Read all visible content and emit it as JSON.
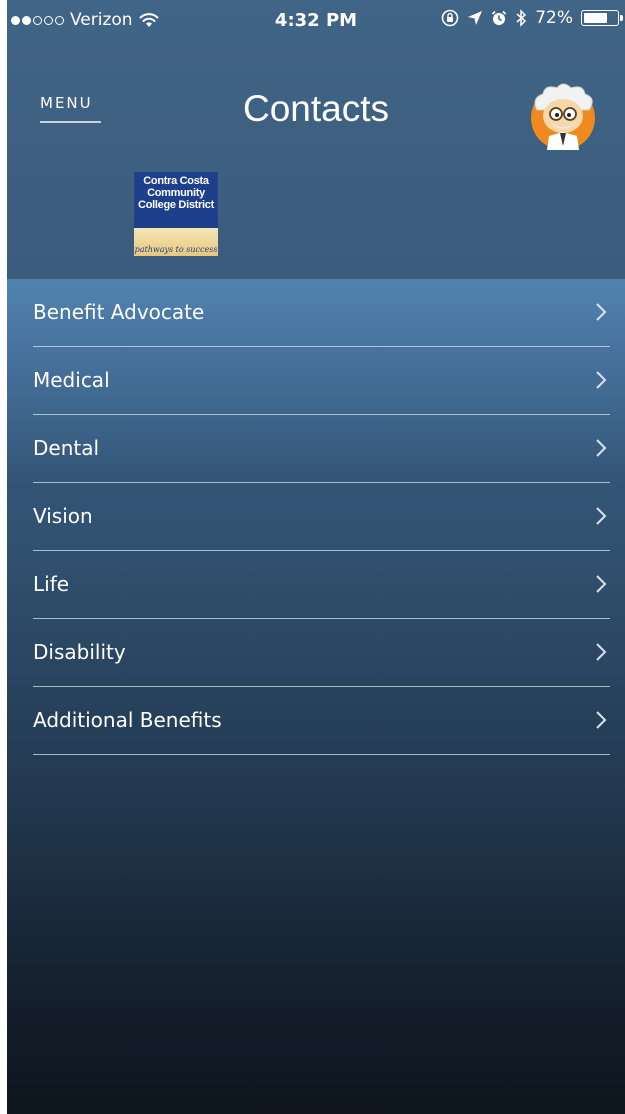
{
  "status_bar": {
    "carrier": "Verizon",
    "time": "4:32 PM",
    "battery": "72%",
    "battery_level": 0.72,
    "signal_bars_filled": 2,
    "signal_bars_total": 5
  },
  "header": {
    "menu_label": "MENU",
    "title": "Contacts"
  },
  "logo": {
    "line1": "Contra Costa",
    "line2": "Community",
    "line3": "College District",
    "tagline": "pathways to success"
  },
  "list": {
    "items": [
      {
        "label": "Benefit Advocate"
      },
      {
        "label": "Medical"
      },
      {
        "label": "Dental"
      },
      {
        "label": "Vision"
      },
      {
        "label": "Life"
      },
      {
        "label": "Disability"
      },
      {
        "label": "Additional Benefits"
      }
    ]
  },
  "icons": {
    "wifi": "wifi-icon",
    "rotation_lock": "rotation-lock-icon",
    "location": "location-arrow-icon",
    "alarm": "alarm-clock-icon",
    "bluetooth": "bluetooth-icon",
    "battery": "battery-icon",
    "chevron": "chevron-right-icon",
    "avatar": "scientist-avatar-icon"
  },
  "colors": {
    "header_bg": "#3f6283",
    "list_highlight": "#5284b0",
    "bottom_bg": "#0e151e",
    "divider": "#d6e2ec",
    "text": "#ffffff"
  }
}
